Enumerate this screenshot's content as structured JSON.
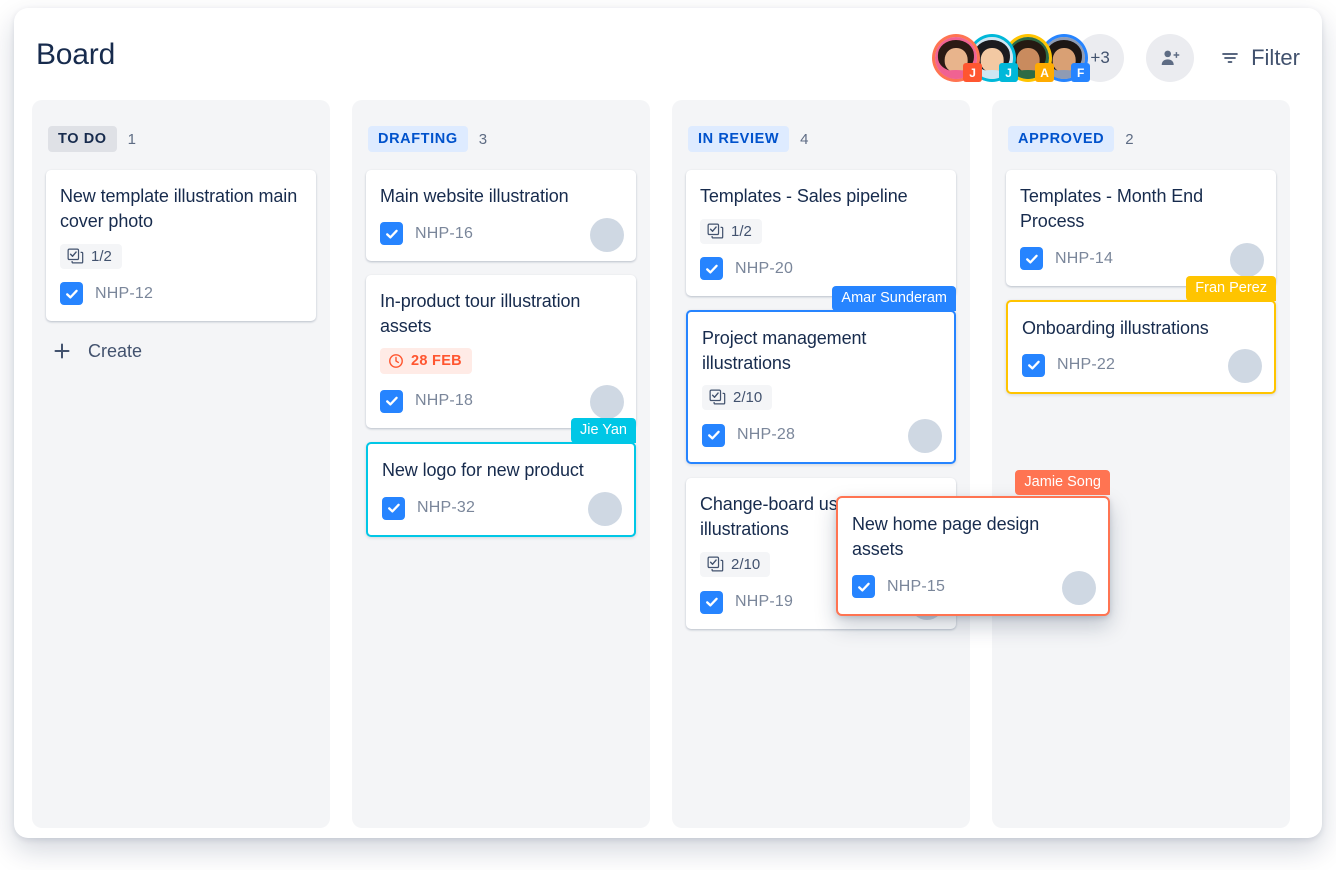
{
  "header": {
    "title": "Board",
    "filter_label": "Filter",
    "filter_icon": "filter-icon",
    "add_person_icon": "add-person-icon",
    "avatar_overflow": "+3",
    "avatars": [
      {
        "name": "Jamie Song",
        "initial": "J",
        "ring": "#FF7452",
        "badge": "#FF5630",
        "hair": "#2b1a14",
        "skin": "#e8b48c",
        "bg": "#f06292"
      },
      {
        "name": "Jie Yan",
        "initial": "J",
        "ring": "#00B8D9",
        "badge": "#00B8D9",
        "hair": "#1b1b1f",
        "skin": "#f2c9a3",
        "bg": "#cfe6f2"
      },
      {
        "name": "Amar Sunderam",
        "initial": "A",
        "ring": "#FFC400",
        "badge": "#FFAB00",
        "hair": "#241a12",
        "skin": "#c98b5e",
        "bg": "#2e6b45"
      },
      {
        "name": "Fran Perez",
        "initial": "F",
        "ring": "#2684FF",
        "badge": "#2684FF",
        "hair": "#1d1614",
        "skin": "#d9a074",
        "bg": "#8f9bb3"
      }
    ]
  },
  "columns": [
    {
      "name": "TO DO",
      "count": "1",
      "badge_bg": "#DFE1E6",
      "badge_color": "#172B4D",
      "show_create": true,
      "create_label": "Create",
      "cards": [
        {
          "title": "New template illustration main cover photo",
          "subtasks": "1/2",
          "key": "NHP-12",
          "avatar": null,
          "highlight": null,
          "tag": null
        }
      ]
    },
    {
      "name": "DRAFTING",
      "count": "3",
      "badge_bg": "#DEEBFF",
      "badge_color": "#0052CC",
      "show_create": false,
      "create_label": "",
      "cards": [
        {
          "title": "Main website illustration",
          "subtasks": null,
          "key": "NHP-16",
          "avatar": {
            "hair": "#241a12",
            "skin": "#c98b5e",
            "bg": "#2e6b45"
          },
          "highlight": null,
          "tag": null
        },
        {
          "title": "In-product tour illustration assets",
          "due": "28 FEB",
          "due_icon": "clock-icon",
          "subtasks": null,
          "key": "NHP-18",
          "avatar": {
            "hair": "#2a1c14",
            "skin": "#b5764a",
            "bg": "#8a5a3c"
          },
          "highlight": null,
          "tag": null
        },
        {
          "title": "New logo for new product",
          "subtasks": null,
          "key": "NHP-32",
          "avatar": {
            "hair": "#16161a",
            "skin": "#f2c9a3",
            "bg": "#cfe6f2"
          },
          "highlight": "#00C7E6",
          "tag": {
            "text": "Jie Yan",
            "color": "#00C7E6"
          }
        }
      ]
    },
    {
      "name": "IN REVIEW",
      "count": "4",
      "badge_bg": "#DEEBFF",
      "badge_color": "#0052CC",
      "show_create": false,
      "create_label": "",
      "cards": [
        {
          "title": "Templates - Sales pipeline",
          "subtasks": "1/2",
          "key": "NHP-20",
          "avatar": null,
          "highlight": null,
          "tag": null
        },
        {
          "title": "Project management illustrations",
          "subtasks": "2/10",
          "key": "NHP-28",
          "avatar": {
            "hair": "#241a12",
            "skin": "#c98b5e",
            "bg": "#2e6b45"
          },
          "highlight": "#2684FF",
          "tag": {
            "text": "Amar Sunderam",
            "color": "#2684FF"
          }
        },
        {
          "title": "Change-board users illustrations",
          "subtasks": "2/10",
          "key": "NHP-19",
          "avatar": {
            "hair": "#241a12",
            "skin": "#c98b5e",
            "bg": "#2e6b45"
          },
          "highlight": null,
          "tag": null
        }
      ]
    },
    {
      "name": "APPROVED",
      "count": "2",
      "badge_bg": "#DEEBFF",
      "badge_color": "#0052CC",
      "show_create": false,
      "create_label": "",
      "cards": [
        {
          "title": "Templates - Month End Process",
          "subtasks": null,
          "key": "NHP-14",
          "avatar": {
            "hair": "#16161a",
            "skin": "#f2c9a3",
            "bg": "#cfe6f2"
          },
          "highlight": null,
          "tag": null
        },
        {
          "title": "Onboarding illustrations",
          "subtasks": null,
          "key": "NHP-22",
          "avatar": {
            "hair": "#1d1614",
            "skin": "#d9a074",
            "bg": "#8f9bb3"
          },
          "highlight": "#FFC400",
          "tag": {
            "text": "Fran Perez",
            "color": "#FFC400"
          }
        }
      ]
    }
  ],
  "drag_card": {
    "title": "New home page design assets",
    "key": "NHP-15",
    "border_color": "#FF7452",
    "tag": {
      "text": "Jamie Song",
      "color": "#FF7452"
    },
    "avatar": {
      "hair": "#2b1a14",
      "skin": "#e8b48c",
      "bg": "#f06292"
    }
  }
}
